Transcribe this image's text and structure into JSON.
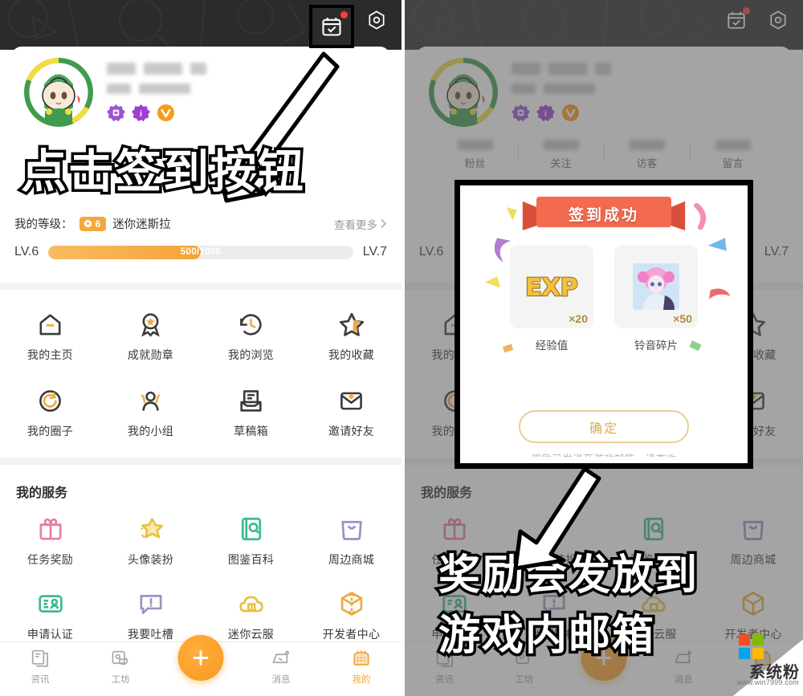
{
  "header": {
    "signin_icon": "calendar-check-icon",
    "settings_icon": "gear-hex-icon",
    "badge_dot": "new-indicator"
  },
  "profile": {
    "avatar_icon": "game-mascot-avatar",
    "nickname_masked": "",
    "subtitle_masked": "",
    "badges": [
      {
        "name": "purple-medal-badge",
        "glyph": ""
      },
      {
        "name": "purple-info-badge",
        "glyph": "i"
      },
      {
        "name": "orange-v-badge",
        "glyph": "V"
      }
    ],
    "stats": [
      {
        "label": "粉丝",
        "value_masked": ""
      },
      {
        "label": "关注",
        "value_masked": ""
      },
      {
        "label": "访客",
        "value_masked": ""
      },
      {
        "label": "留言",
        "value_masked": ""
      }
    ]
  },
  "level": {
    "label": "我的等级：",
    "badge_number": "6",
    "badge_icon": "gear-flower-icon",
    "title": "迷你迷斯拉",
    "more_label": "查看更多",
    "more_icon": "chevron-right-icon",
    "current_level": "LV.6",
    "next_level": "LV.7",
    "progress_text": "500/1000",
    "progress_current": 500,
    "progress_max": 1000,
    "progress_percent": 50,
    "fill_color": "#f5a33a",
    "track_color": "#ececec"
  },
  "quick_grid": [
    {
      "label": "我的主页",
      "icon": "home-icon",
      "color": "#3b3b3b"
    },
    {
      "label": "成就勋章",
      "icon": "medal-icon",
      "color": "#3b3b3b"
    },
    {
      "label": "我的浏览",
      "icon": "history-clock-icon",
      "color": "#3b3b3b"
    },
    {
      "label": "我的收藏",
      "icon": "star-icon",
      "color": "#3b3b3b"
    },
    {
      "label": "我的圈子",
      "icon": "circle-refresh-icon",
      "color": "#3b3b3b"
    },
    {
      "label": "我的小组",
      "icon": "group-person-icon",
      "color": "#eab14f"
    },
    {
      "label": "草稿箱",
      "icon": "draft-box-icon",
      "color": "#3b3b3b"
    },
    {
      "label": "邀请好友",
      "icon": "invite-envelope-icon",
      "color": "#3b3b3b"
    }
  ],
  "services": {
    "title": "我的服务",
    "items": [
      {
        "label": "任务奖励",
        "icon": "gift-icon",
        "color": "#e87fa4"
      },
      {
        "label": "头像装扮",
        "icon": "sparkle-star-icon",
        "color": "#e9c13f"
      },
      {
        "label": "图鉴百科",
        "icon": "book-search-icon",
        "color": "#3fb98a"
      },
      {
        "label": "周边商城",
        "icon": "shopping-bag-icon",
        "color": "#a08cc8"
      },
      {
        "label": "申请认证",
        "icon": "certify-id-icon",
        "color": "#3fb98a"
      },
      {
        "label": "我要吐槽",
        "icon": "feedback-bubble-icon",
        "color": "#9b93c4"
      },
      {
        "label": "迷你云服",
        "icon": "cloud-server-icon",
        "color": "#e9c13f"
      },
      {
        "label": "开发者中心",
        "icon": "cube-dev-icon",
        "color": "#eeab45"
      }
    ]
  },
  "tabbar": {
    "items": [
      {
        "label": "资讯",
        "icon": "news-icon",
        "active": false
      },
      {
        "label": "工坊",
        "icon": "workshop-icon",
        "active": false
      },
      {
        "label": "",
        "icon": "plus-fab-icon",
        "active": false
      },
      {
        "label": "消息",
        "icon": "message-icon",
        "active": false
      },
      {
        "label": "我的",
        "icon": "profile-icon",
        "active": true
      }
    ],
    "active_color": "#f3a43c",
    "inactive_color": "#9b9b9b"
  },
  "annotations": {
    "left_caption": "点击签到按钮",
    "right_caption_line1": "奖励会发放到",
    "right_caption_line2": "游戏内邮箱",
    "arrow_icon": "callout-arrow-icon",
    "highlight_icon": "highlight-box"
  },
  "modal": {
    "ribbon_title": "签到成功",
    "ribbon_color": "#f26a50",
    "rewards": [
      {
        "name": "经验值",
        "qty": "×20",
        "icon": "exp-token-icon"
      },
      {
        "name": "铃音碎片",
        "qty": "×50",
        "icon": "character-shard-icon"
      }
    ],
    "confirm_label": "确定",
    "confirm_border_color": "#e7cf93",
    "confirm_text_color": "#d8ad51",
    "footer_note": "奖励已发送至游戏邮箱，请查收"
  },
  "watermark": {
    "text": "系统粉",
    "url": "www.win7999.com",
    "logo_icon": "four-square-logo",
    "colors": [
      "#f25022",
      "#7fba00",
      "#00a4ef",
      "#ffb900"
    ]
  }
}
